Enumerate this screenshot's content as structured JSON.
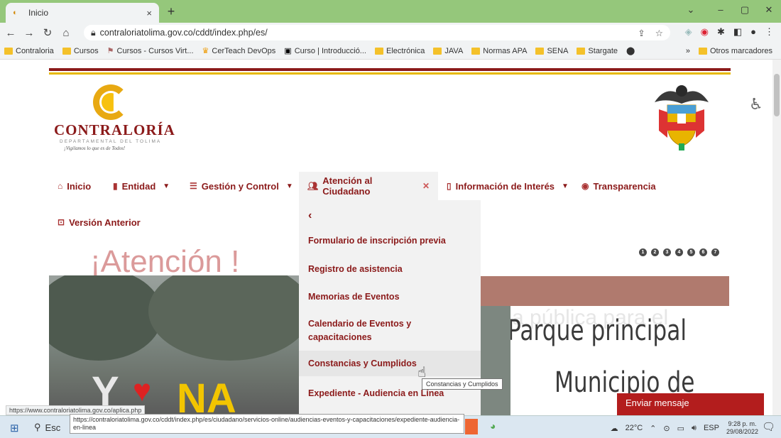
{
  "browser": {
    "tab_title": "Inicio",
    "tab_close": "×",
    "new_tab": "+",
    "url": "contraloriatolima.gov.co/cddt/index.php/es/",
    "window_controls": [
      "⌄",
      "–",
      "▢",
      "✕"
    ]
  },
  "bookmarks": {
    "items": [
      "Contraloria",
      "Cursos",
      "Cursos - Cursos Virt...",
      "CerTeach DevOps",
      "Curso | Introducció...",
      "Electrónica",
      "JAVA",
      "Normas APA",
      "SENA",
      "Stargate"
    ],
    "overflow": "»",
    "other": "Otros marcadores"
  },
  "site": {
    "logo_name": "CONTRALORÍA",
    "logo_sub": "DEPARTAMENTAL DEL TOLIMA",
    "logo_slogan": "¡Vigilamos lo que es de Todos!"
  },
  "nav": {
    "inicio": "Inicio",
    "entidad": "Entidad",
    "gestion": "Gestión y Control",
    "atencion": "Atención al Ciudadano",
    "info": "Información de Interés",
    "transparencia": "Transparencia",
    "version": "Versión Anterior"
  },
  "dropdown": {
    "back": "‹",
    "items": [
      "Formulario de inscripción previa",
      "Registro de asistencia",
      "Memorias de Eventos",
      "Calendario de Eventos y capacitaciones",
      "Constancias y Cumplidos",
      "Expediente - Audiencia en Línea"
    ]
  },
  "slider": {
    "dots": [
      "1",
      "2",
      "3",
      "4",
      "5",
      "6",
      "7"
    ],
    "atencion_text": "¡Atención !",
    "ghost_text": "a pública para el",
    "title_line1": "Parque principal",
    "title_line2": "Municipio de"
  },
  "tooltip": "Constancias y Cumplidos",
  "chat_button": "Enviar mensaje",
  "status_url": "https://www.contraloriatolima.gov.co/aplica.php",
  "link_preview": "https://contraloriatolima.gov.co/cddt/index.php/es/ciudadano/servicios-online/audiencias-eventos-y-capacitaciones/expediente-audiencia-en-linea",
  "taskbar": {
    "search_label": "Esc",
    "weather": "22°C",
    "lang": "ESP",
    "time": "9:28 p. m.",
    "date": "29/08/2022"
  }
}
